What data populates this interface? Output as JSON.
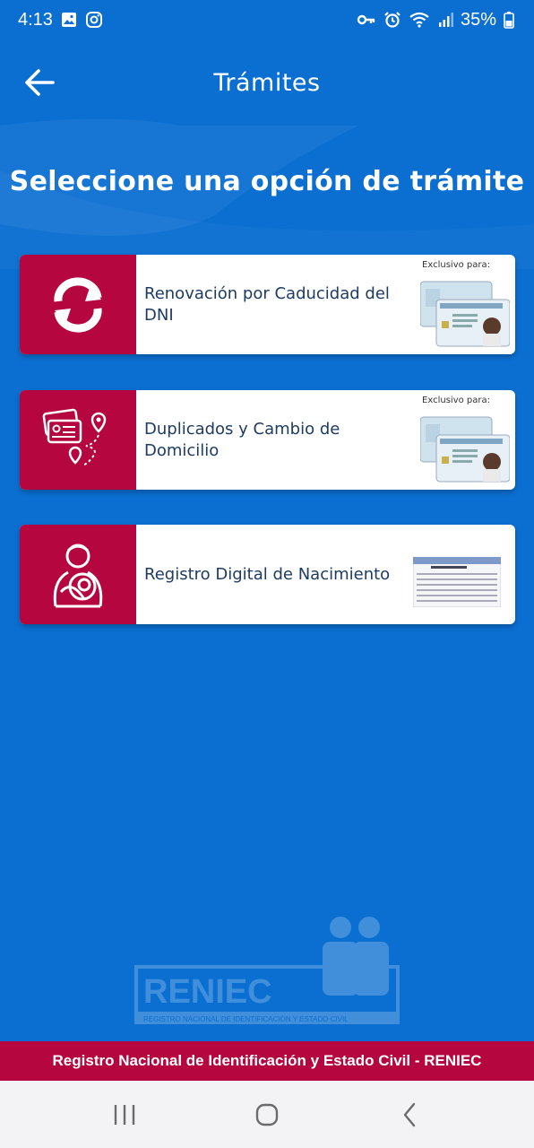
{
  "status": {
    "time": "4:13",
    "battery": "35%",
    "icons": [
      "gallery-icon",
      "instagram-icon",
      "key-icon",
      "alarm-icon",
      "wifi-icon",
      "signal-icon",
      "battery-icon"
    ]
  },
  "appbar": {
    "title": "Trámites",
    "back_icon": "arrow-left-icon"
  },
  "heading": "Seleccione una opción de trámite",
  "cards": [
    {
      "label": "Renovación por Caducidad del DNI",
      "icon": "renew-cycle-icon",
      "exclusive_label": "Exclusivo para:",
      "thumbnail": "dni-cards-image"
    },
    {
      "label": "Duplicados y Cambio de Domicilio",
      "icon": "id-cards-location-icon",
      "exclusive_label": "Exclusivo para:",
      "thumbnail": "dni-cards-image"
    },
    {
      "label": "Registro Digital de Nacimiento",
      "icon": "mother-baby-icon",
      "thumbnail": "birth-certificate-image"
    }
  ],
  "watermark": {
    "brand": "RENIEC",
    "subtitle": "REGISTRO NACIONAL DE IDENTIFICACIÓN Y ESTADO CIVIL"
  },
  "footer": "Registro Nacional de Identificación y Estado Civil - RENIEC",
  "navbar": {
    "recents_icon": "recents-icon",
    "home_icon": "home-icon",
    "back_icon": "back-icon"
  },
  "colors": {
    "background": "#0b6fd1",
    "accent": "#b5063f",
    "card": "#ffffff",
    "card_text": "#1d3b63"
  }
}
